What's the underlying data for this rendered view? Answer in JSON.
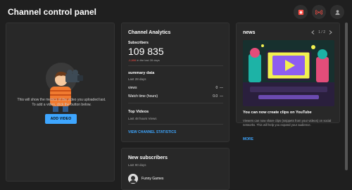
{
  "header": {
    "title": "Channel control panel",
    "icons": [
      "upload-icon",
      "live-icon",
      "account-icon"
    ]
  },
  "empty_state": {
    "text_line1": "This will show the metrics of the video you uploaded last.",
    "text_line2": "To add a video, click the button below.",
    "button_label": "ADD VIDEO"
  },
  "analytics": {
    "title": "Channel Analytics",
    "subscribers_label": "Subscribers",
    "subscribers_value": "109 835",
    "subscribers_change": "-1,606",
    "subscribers_change_suffix": "in the last 28 days",
    "summary_title": "summary data",
    "summary_period": "Last 28 days",
    "views_label": "views",
    "views_value": "0",
    "views_trend": "—",
    "watch_label": "Watch time (hours)",
    "watch_value": "0.0",
    "watch_trend": "—",
    "top_videos_title": "Top Videos",
    "top_videos_period": "Last 48 hours Views",
    "view_stats_link": "VIEW CHANNEL STATISTICS"
  },
  "news": {
    "title": "news",
    "page": "1 / 2",
    "prev_icon": "chevron-left-icon",
    "next_icon": "chevron-right-icon",
    "headline": "You can now create clips on YouTube",
    "body": "Viewers can now share clips (snippets from your videos) on social networks. This will help you expand your audience.",
    "more_link": "MORE"
  },
  "new_subscribers": {
    "title": "New subscribers",
    "period": "Last 90 days",
    "first_name": "Funny Games"
  },
  "colors": {
    "background": "#1f1f1f",
    "card": "#282828",
    "accent": "#3ea6ff",
    "negative": "#ff4e45"
  }
}
